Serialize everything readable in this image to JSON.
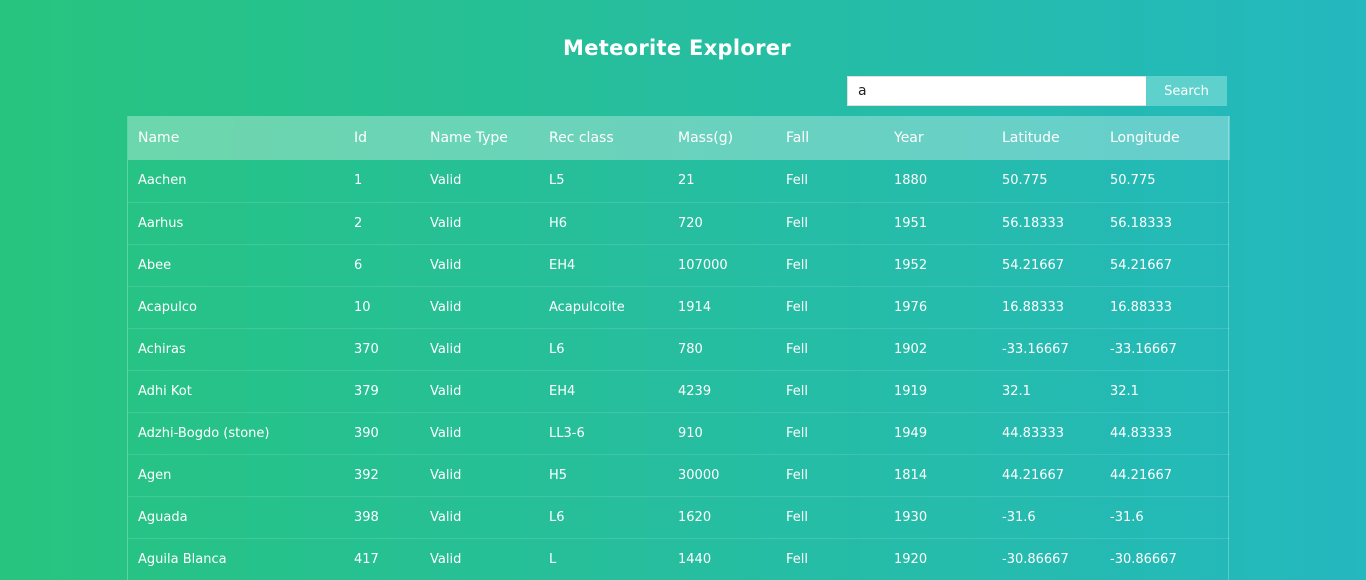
{
  "header": {
    "title": "Meteorite Explorer"
  },
  "search": {
    "value": "a",
    "button_label": "Search"
  },
  "table": {
    "columns": [
      "Name",
      "Id",
      "Name Type",
      "Rec class",
      "Mass(g)",
      "Fall",
      "Year",
      "Latitude",
      "Longitude"
    ],
    "rows": [
      [
        "Aachen",
        "1",
        "Valid",
        "L5",
        "21",
        "Fell",
        "1880",
        "50.775",
        "50.775"
      ],
      [
        "Aarhus",
        "2",
        "Valid",
        "H6",
        "720",
        "Fell",
        "1951",
        "56.18333",
        "56.18333"
      ],
      [
        "Abee",
        "6",
        "Valid",
        "EH4",
        "107000",
        "Fell",
        "1952",
        "54.21667",
        "54.21667"
      ],
      [
        "Acapulco",
        "10",
        "Valid",
        "Acapulcoite",
        "1914",
        "Fell",
        "1976",
        "16.88333",
        "16.88333"
      ],
      [
        "Achiras",
        "370",
        "Valid",
        "L6",
        "780",
        "Fell",
        "1902",
        "-33.16667",
        "-33.16667"
      ],
      [
        "Adhi Kot",
        "379",
        "Valid",
        "EH4",
        "4239",
        "Fell",
        "1919",
        "32.1",
        "32.1"
      ],
      [
        "Adzhi-Bogdo (stone)",
        "390",
        "Valid",
        "LL3-6",
        "910",
        "Fell",
        "1949",
        "44.83333",
        "44.83333"
      ],
      [
        "Agen",
        "392",
        "Valid",
        "H5",
        "30000",
        "Fell",
        "1814",
        "44.21667",
        "44.21667"
      ],
      [
        "Aguada",
        "398",
        "Valid",
        "L6",
        "1620",
        "Fell",
        "1930",
        "-31.6",
        "-31.6"
      ],
      [
        "Aguila Blanca",
        "417",
        "Valid",
        "L",
        "1440",
        "Fell",
        "1920",
        "-30.86667",
        "-30.86667"
      ]
    ]
  },
  "colors": {
    "gradient_start": "#27c47f",
    "gradient_end": "#24b8bf",
    "search_button": "#5ed1cc"
  }
}
